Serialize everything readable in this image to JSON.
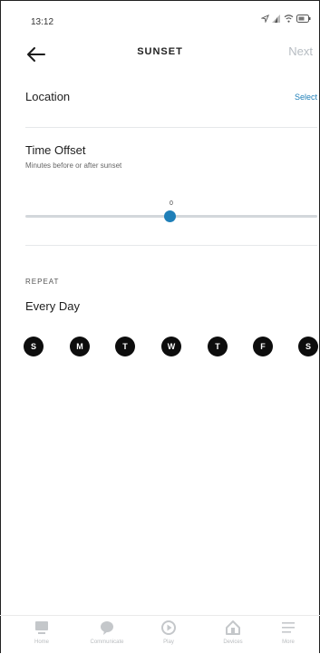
{
  "status_bar": {
    "time": "13:12"
  },
  "header": {
    "title": "SUNSET",
    "next_label": "Next"
  },
  "location": {
    "label": "Location",
    "action_label": "Select"
  },
  "time_offset": {
    "title": "Time Offset",
    "subtitle": "Minutes before or after sunset",
    "value": "0"
  },
  "repeat": {
    "section_label": "REPEAT",
    "value": "Every Day",
    "days": [
      "S",
      "M",
      "T",
      "W",
      "T",
      "F",
      "S"
    ]
  },
  "bottom_nav": {
    "items": [
      {
        "label": "Home",
        "icon": "home-icon"
      },
      {
        "label": "Communicate",
        "icon": "chat-bubble-icon"
      },
      {
        "label": "Play",
        "icon": "play-icon"
      },
      {
        "label": "Devices",
        "icon": "devices-icon"
      },
      {
        "label": "More",
        "icon": "menu-icon"
      }
    ]
  },
  "colors": {
    "accent": "#1f7fb8",
    "day_circle": "#0d0d0d",
    "disabled_text": "#b6bcc2"
  }
}
